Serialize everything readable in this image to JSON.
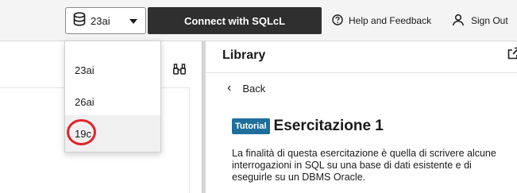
{
  "toolbar": {
    "db_selected": "23ai",
    "connect_label": "Connect with SQLcL",
    "help_label": "Help and Feedback",
    "signout_label": "Sign Out"
  },
  "db_dropdown": {
    "options": [
      "23ai",
      "26ai",
      "19c"
    ],
    "highlighted": "19c"
  },
  "library": {
    "title": "Library",
    "back_label": "Back",
    "badge": "Tutorial",
    "heading": "Esercitazione 1",
    "description": "La finalità di questa esercitazione è quella di scrivere alcune interrogazioni in SQL su una base di dati esistente e di eseguirle su un DBMS Oracle."
  },
  "workspace": {
    "tool_icon": "binoculars-icon"
  },
  "colors": {
    "connect_button": "#2f2f2f",
    "tutorial_badge": "#1f6f9c",
    "annotation_circle": "#e0232b"
  }
}
